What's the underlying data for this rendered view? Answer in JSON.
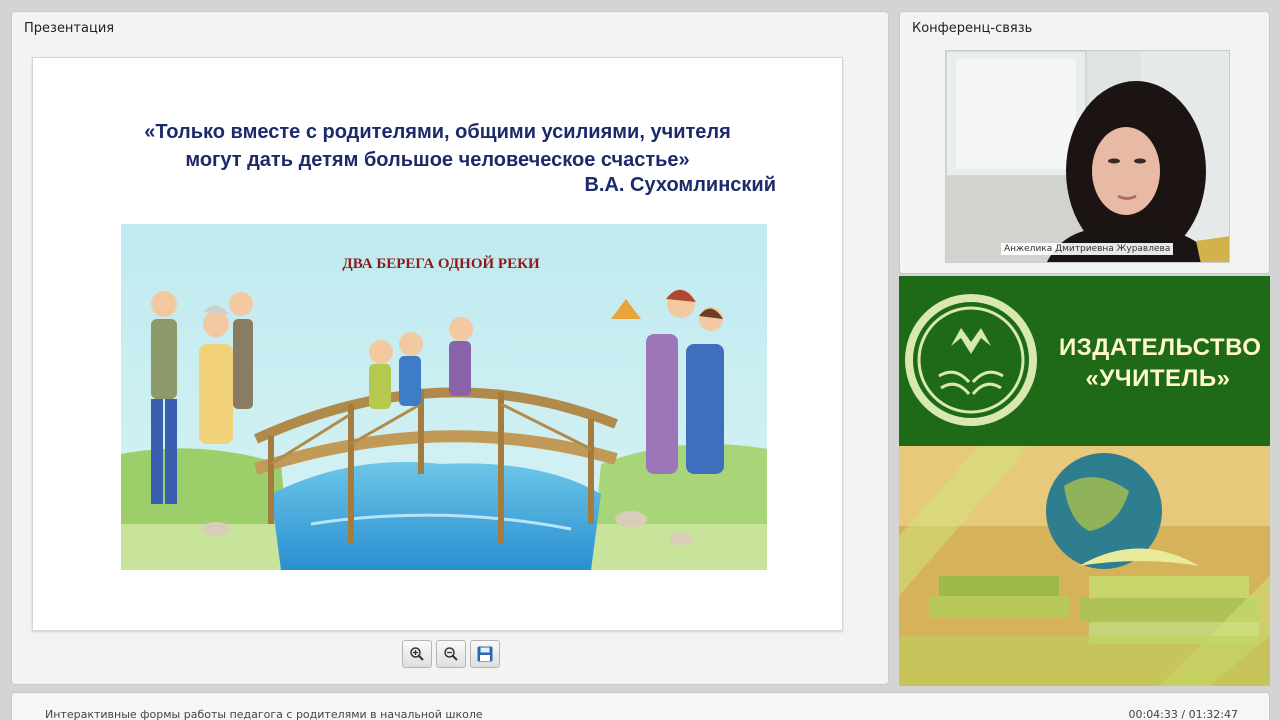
{
  "presentation": {
    "title": "Презентация",
    "slide": {
      "quote_line1": "«Только вместе с родителями, общими усилиями, учителя",
      "quote_line2": "могут  дать детям большое человеческое счастье»",
      "author": "В.А. Сухомлинский",
      "illustration_title": "ДВА БЕРЕГА ОДНОЙ РЕКИ"
    },
    "toolbar": {
      "zoom_in_icon": "zoom-in-icon",
      "zoom_out_icon": "zoom-out-icon",
      "save_icon": "save-icon"
    }
  },
  "conference": {
    "title": "Конференц-связь",
    "speaker_name": "Анжелика Дмитриевна Журавлева"
  },
  "ad": {
    "publisher_line1": "ИЗДАТЕЛЬСТВО",
    "publisher_line2": "«УЧИТЕЛЬ»",
    "colors": {
      "green": "#1e6a16",
      "cream": "#fff8cc"
    }
  },
  "footer": {
    "course_title": "Интерактивные формы работы педагога с родителями в начальной школе",
    "time": "00:04:33 / 01:32:47"
  }
}
